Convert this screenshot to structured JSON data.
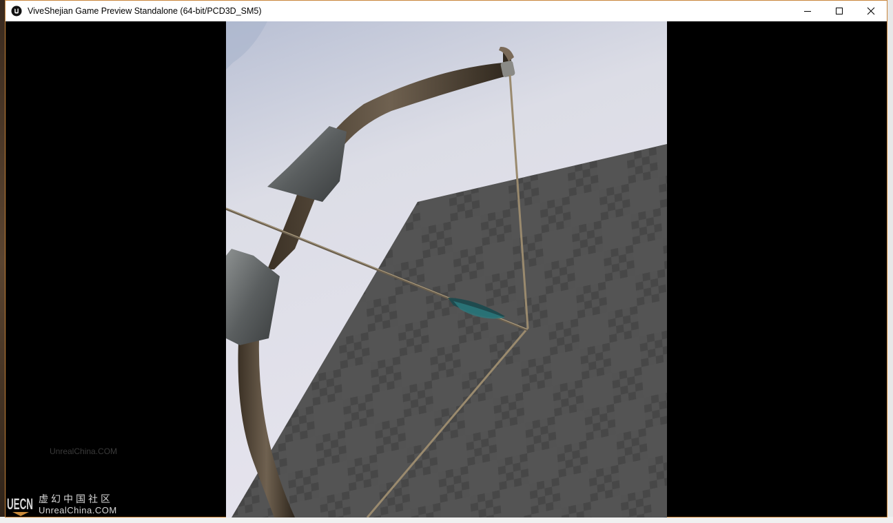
{
  "window": {
    "title": "ViveShejian Game Preview Standalone (64-bit/PCD3D_SM5)",
    "app_icon": "unreal-engine-icon",
    "controls": {
      "minimize": "minimize-icon",
      "maximize": "maximize-icon",
      "close": "close-icon"
    },
    "border_color": "#c9853a"
  },
  "viewport": {
    "sky_color": "#d9d9e6",
    "floor_color": "#4a4a4a",
    "objects": [
      "bow",
      "bowstring",
      "arrow",
      "checkered-floor"
    ]
  },
  "watermark": {
    "faint_text": "UnrealChina.COM",
    "logo_mark": "UECN",
    "logo_cn": "虚幻中国社区",
    "logo_en": "UnrealChina.COM"
  }
}
